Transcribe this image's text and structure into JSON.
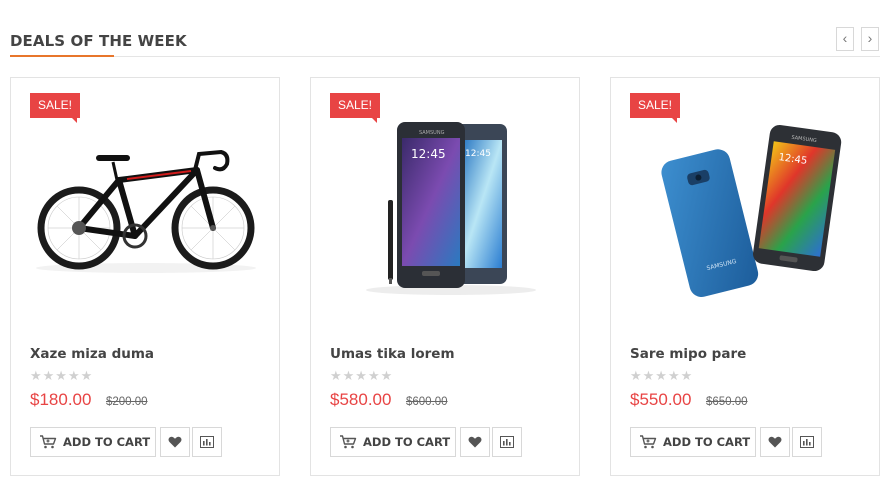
{
  "section": {
    "title": "DEALS OF THE WEEK",
    "prev_label": "‹",
    "next_label": "›"
  },
  "colors": {
    "accent": "#e8762b",
    "sale": "#e84444",
    "price": "#e84444"
  },
  "products": [
    {
      "badge": "SALE!",
      "image": "road-bicycle",
      "name": "Xaze miza duma",
      "stars": "★★★★★",
      "rating": 0,
      "price": "$180.00",
      "old_price": "$200.00",
      "cart_label": "ADD TO CART"
    },
    {
      "badge": "SALE!",
      "image": "two-smartphones-with-stylus",
      "name": "Umas tika lorem",
      "stars": "★★★★★",
      "rating": 0,
      "price": "$580.00",
      "old_price": "$600.00",
      "cart_label": "ADD TO CART"
    },
    {
      "badge": "SALE!",
      "image": "blue-smartphone-pair",
      "name": "Sare mipo pare",
      "stars": "★★★★★",
      "rating": 0,
      "price": "$550.00",
      "old_price": "$650.00",
      "cart_label": "ADD TO CART"
    }
  ]
}
